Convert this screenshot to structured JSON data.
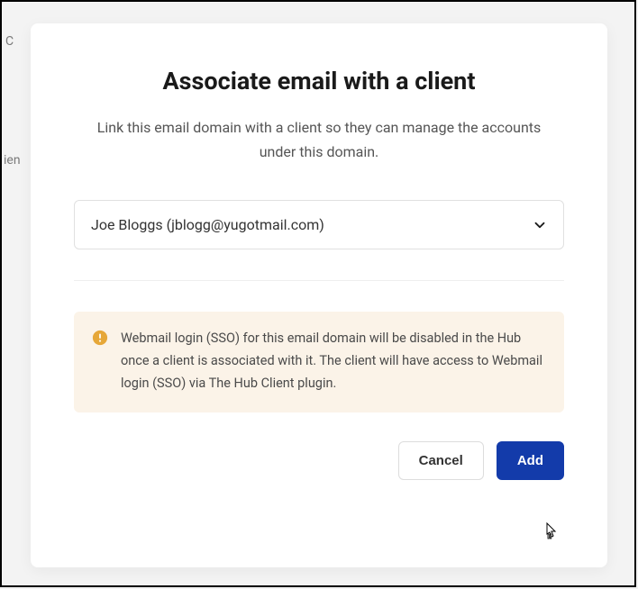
{
  "modal": {
    "title": "Associate email with a client",
    "description": "Link this email domain with a client so they can manage the accounts under this domain.",
    "select": {
      "selected_label": "Joe Bloggs (jblogg@yugotmail.com)"
    },
    "alert": {
      "text": "Webmail login (SSO) for this email domain will be disabled in the Hub once a client is associated with it. The client will have access to Webmail login (SSO) via The Hub Client plugin."
    },
    "actions": {
      "cancel_label": "Cancel",
      "add_label": "Add"
    }
  },
  "bg": {
    "t1": "C",
    "t2": "ien"
  }
}
